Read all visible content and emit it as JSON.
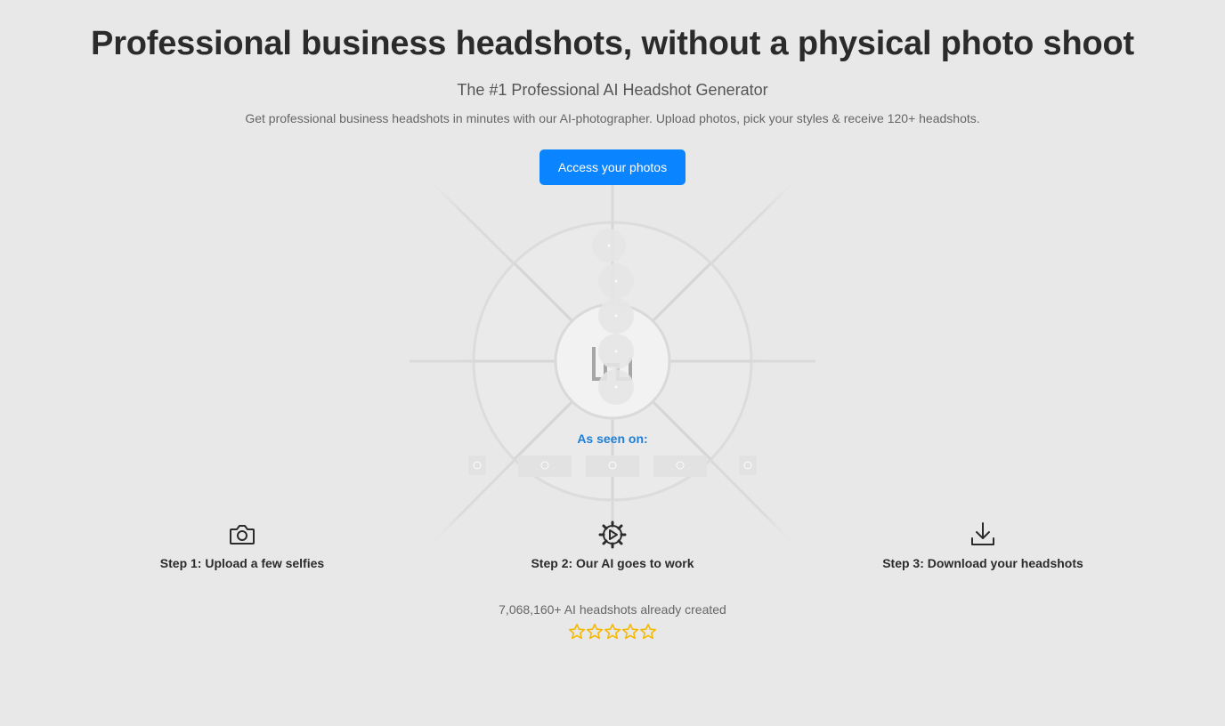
{
  "hero": {
    "title": "Professional business headshots, without a physical photo shoot",
    "subtitle": "The #1 Professional AI Headshot Generator",
    "description": "Get professional business headshots in minutes with our AI-photographer. Upload photos, pick your styles & receive 120+ headshots.",
    "cta_label": "Access your photos"
  },
  "press": {
    "label": "As seen on:"
  },
  "steps": [
    {
      "icon": "camera-icon",
      "label": "Step 1: Upload a few selfies"
    },
    {
      "icon": "gear-play-icon",
      "label": "Step 2: Our AI goes to work"
    },
    {
      "icon": "download-icon",
      "label": "Step 3: Download your headshots"
    }
  ],
  "social_proof": {
    "counter_text": "7,068,160+ AI headshots already created",
    "rating_stars": 5
  },
  "colors": {
    "background": "#e8e8e8",
    "accent": "#0a84ff",
    "seen_label": "#1f7fd6",
    "star": "#f5b800"
  }
}
